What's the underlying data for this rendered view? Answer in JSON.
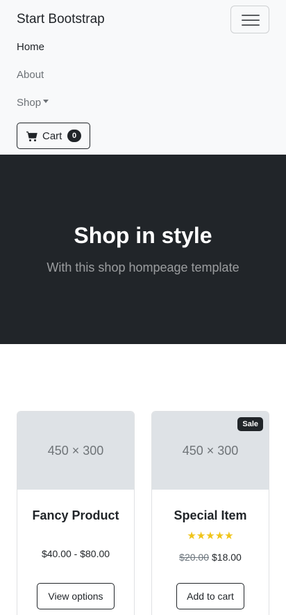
{
  "navbar": {
    "brand": "Start Bootstrap",
    "toggler_icon": "hamburger-icon",
    "links": [
      {
        "label": "Home",
        "active": true
      },
      {
        "label": "About",
        "active": false
      },
      {
        "label": "Shop",
        "active": false,
        "dropdown": true
      }
    ],
    "cart": {
      "label": "Cart",
      "count": "0",
      "icon": "cart-icon"
    }
  },
  "hero": {
    "title": "Shop in style",
    "subtitle": "With this shop hompeage template",
    "background": "#212529"
  },
  "products": [
    {
      "image_placeholder": "450 × 300",
      "name": "Fancy Product",
      "price_range": "$40.00 - $80.00",
      "button": "View options"
    },
    {
      "image_placeholder": "450 × 300",
      "badge": "Sale",
      "name": "Special Item",
      "rating": 5,
      "rating_max": 5,
      "price_old": "$20.00",
      "price": "$18.00",
      "button": "Add to cart"
    }
  ],
  "colors": {
    "dark": "#212529",
    "navbar_bg": "#f8f9fa",
    "star": "#f0c419",
    "placeholder_bg": "#dee2e6"
  }
}
